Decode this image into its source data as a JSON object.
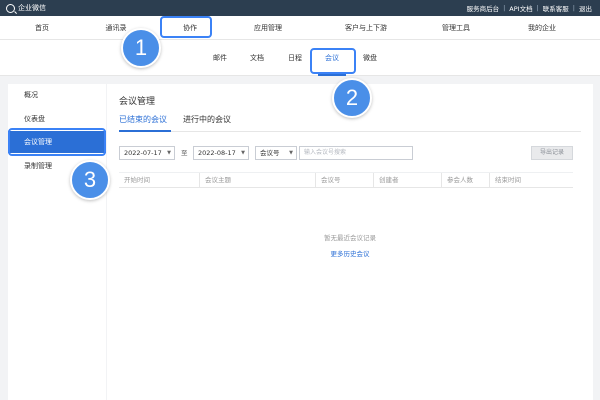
{
  "app": {
    "title": "企业微信"
  },
  "topbar_links": [
    "服务商后台",
    "API文档",
    "联系客服",
    "退出"
  ],
  "main_nav": [
    "首页",
    "通讯录",
    "协作",
    "应用管理",
    "客户与上下游",
    "管理工具",
    "我的企业"
  ],
  "sub_nav": [
    "邮件",
    "文档",
    "日程",
    "会议",
    "微盘"
  ],
  "sidebar": [
    "概况",
    "仪表盘",
    "会议管理",
    "录制管理"
  ],
  "panel": {
    "title": "会议管理",
    "tabs": [
      "已结束的会议",
      "进行中的会议"
    ],
    "date_from": "2022-07-17",
    "date_sep": "至",
    "date_to": "2022-08-17",
    "filter_type": "会议号",
    "search_placeholder": "输入会议号搜索",
    "export_label": "导出记录",
    "columns": [
      "开始时间",
      "会议主题",
      "会议号",
      "创建者",
      "参会人数",
      "结束时间"
    ],
    "empty_text": "暂无最近会议记录",
    "more_link": "更多历史会议"
  },
  "annotations": [
    "1",
    "2",
    "3"
  ],
  "colors": {
    "accent": "#2b6fd6",
    "topbar": "#2c3e50",
    "annotation": "#4a8fe8"
  }
}
